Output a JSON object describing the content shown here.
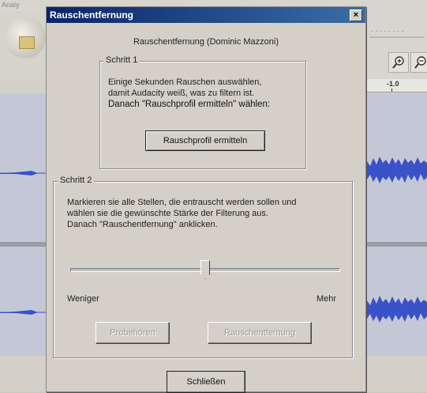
{
  "background": {
    "menu_text": "Analy",
    "ruler_label": "-1.0",
    "icons": [
      "zoom-in-icon",
      "zoom-in-icon"
    ]
  },
  "dialog": {
    "title": "Rauschentfernung",
    "close_label": "×",
    "heading": "Rauschentfernung (Dominic Mazzoni)",
    "step1": {
      "legend": "Schritt 1",
      "lines": [
        "Einige Sekunden Rauschen auswählen,",
        "damit Audacity weiß, was zu filtern ist.",
        "Danach \"Rauschprofil ermitteln\" wählen:"
      ],
      "button": "Rauschprofil ermitteln"
    },
    "step2": {
      "legend": "Schritt 2",
      "lines": [
        "Markieren sie alle Stellen, die entrauscht werden sollen und",
        "wählen sie die gewünschte Stärke der Filterung aus.",
        "Danach \"Rauschentfernung\" anklicken."
      ],
      "slider": {
        "value": 0.5,
        "less_label": "Weniger",
        "more_label": "Mehr"
      },
      "preview_button": "Probehören",
      "remove_button": "Rauschentfernung"
    },
    "close_button": "Schließen"
  }
}
